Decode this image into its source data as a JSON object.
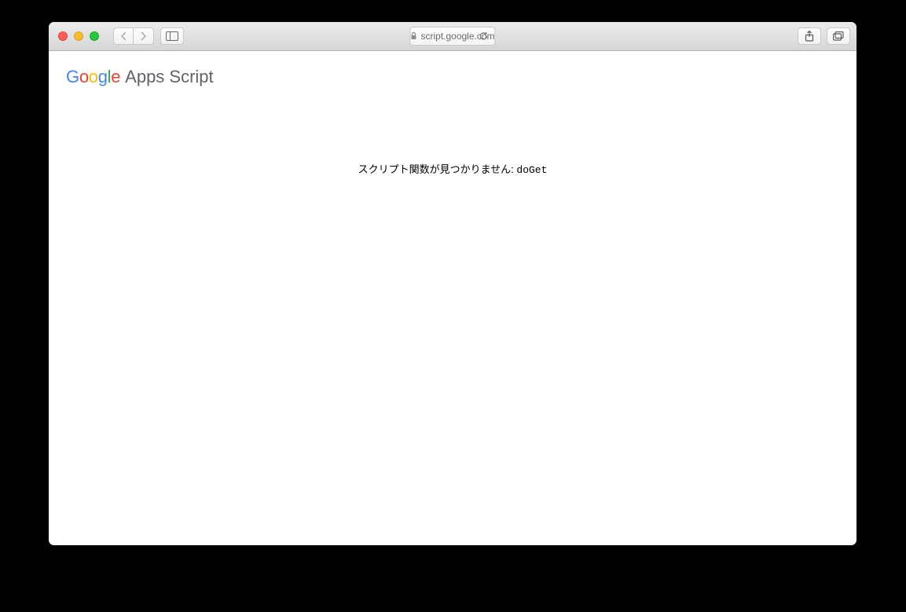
{
  "browser": {
    "url_display": "script.google.com"
  },
  "page": {
    "logo": {
      "g": "G",
      "o1": "o",
      "o2": "o",
      "g2": "g",
      "l": "l",
      "e": "e"
    },
    "product_name": "Apps Script",
    "error_prefix": "スクリプト関数が見つかりません: ",
    "error_fn": "doGet"
  }
}
